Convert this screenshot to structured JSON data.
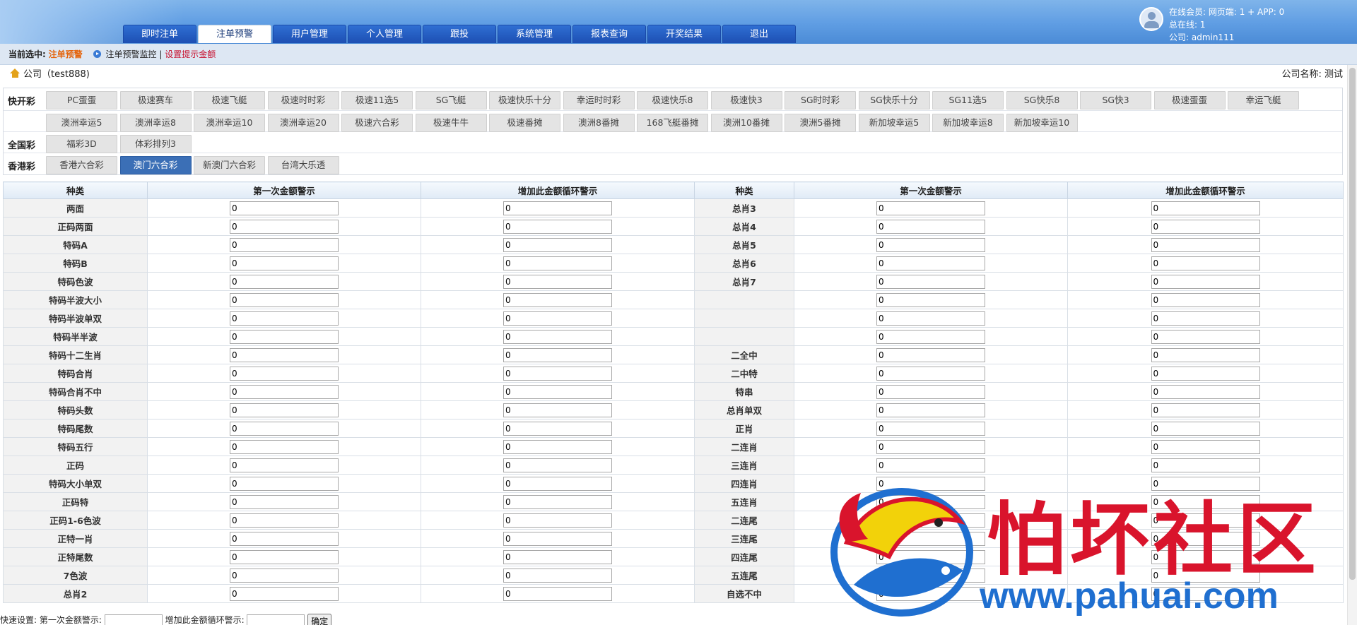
{
  "nav": {
    "tabs": [
      "即时注单",
      "注单预警",
      "用户管理",
      "个人管理",
      "跟投",
      "系统管理",
      "报表查询",
      "开奖结果",
      "退出"
    ],
    "active": 1
  },
  "user": {
    "online": "在线会员:   网页端: 1 + APP: 0",
    "total": "总在线: 1",
    "company": "公司: admin111"
  },
  "crumb": {
    "label": "当前选中:",
    "current": "注单预警",
    "item": "注单预警监控",
    "sep": "|",
    "link": "设置提示金额"
  },
  "company": {
    "title": "公司（test888)",
    "name": "公司名称: 测试"
  },
  "categories": {
    "fast_label": "快开彩",
    "fast_row1": [
      "PC蛋蛋",
      "极速赛车",
      "极速飞艇",
      "极速时时彩",
      "极速11选5",
      "SG飞艇",
      "极速快乐十分",
      "幸运时时彩",
      "极速快乐8",
      "极速快3",
      "SG时时彩",
      "SG快乐十分",
      "SG11选5",
      "SG快乐8",
      "SG快3",
      "极速蛋蛋",
      "幸运飞艇"
    ],
    "fast_row2": [
      "澳洲幸运5",
      "澳洲幸运8",
      "澳洲幸运10",
      "澳洲幸运20",
      "极速六合彩",
      "极速牛牛",
      "极速番摊",
      "澳洲8番摊",
      "168飞艇番摊",
      "澳洲10番摊",
      "澳洲5番摊",
      "新加坡幸运5",
      "新加坡幸运8",
      "新加坡幸运10"
    ],
    "national_label": "全国彩",
    "national": [
      "福彩3D",
      "体彩排列3"
    ],
    "hk_label": "香港彩",
    "hk": [
      "香港六合彩",
      "澳门六合彩",
      "新澳门六合彩",
      "台湾大乐透"
    ],
    "hk_active": 1
  },
  "table": {
    "headers": [
      "种类",
      "第一次金额警示",
      "增加此金额循环警示",
      "种类",
      "第一次金额警示",
      "增加此金额循环警示"
    ],
    "rows": [
      [
        "两面",
        "0",
        "0",
        "总肖3",
        "0",
        "0"
      ],
      [
        "正码两面",
        "0",
        "0",
        "总肖4",
        "0",
        "0"
      ],
      [
        "特码A",
        "0",
        "0",
        "总肖5",
        "0",
        "0"
      ],
      [
        "特码B",
        "0",
        "0",
        "总肖6",
        "0",
        "0"
      ],
      [
        "特码色波",
        "0",
        "0",
        "总肖7",
        "0",
        "0"
      ],
      [
        "特码半波大小",
        "0",
        "0",
        "",
        "0",
        "0"
      ],
      [
        "特码半波单双",
        "0",
        "0",
        "",
        "0",
        "0"
      ],
      [
        "特码半半波",
        "0",
        "0",
        "",
        "0",
        "0"
      ],
      [
        "特码十二生肖",
        "0",
        "0",
        "二全中",
        "0",
        "0"
      ],
      [
        "特码合肖",
        "0",
        "0",
        "二中特",
        "0",
        "0"
      ],
      [
        "特码合肖不中",
        "0",
        "0",
        "特串",
        "0",
        "0"
      ],
      [
        "特码头数",
        "0",
        "0",
        "总肖单双",
        "0",
        "0"
      ],
      [
        "特码尾数",
        "0",
        "0",
        "正肖",
        "0",
        "0"
      ],
      [
        "特码五行",
        "0",
        "0",
        "二连肖",
        "0",
        "0"
      ],
      [
        "正码",
        "0",
        "0",
        "三连肖",
        "0",
        "0"
      ],
      [
        "特码大小单双",
        "0",
        "0",
        "四连肖",
        "0",
        "0"
      ],
      [
        "正码特",
        "0",
        "0",
        "五连肖",
        "0",
        "0"
      ],
      [
        "正码1-6色波",
        "0",
        "0",
        "二连尾",
        "0",
        "0"
      ],
      [
        "正特一肖",
        "0",
        "0",
        "三连尾",
        "0",
        "0"
      ],
      [
        "正特尾数",
        "0",
        "0",
        "四连尾",
        "0",
        "0"
      ],
      [
        "7色波",
        "0",
        "0",
        "五连尾",
        "0",
        "0"
      ],
      [
        "总肖2",
        "0",
        "0",
        "自选不中",
        "0",
        "0"
      ]
    ]
  },
  "quick": {
    "label1": "快速设置:   第一次金额警示:",
    "label2": "增加此金额循环警示:",
    "button": "确定"
  },
  "watermark": {
    "text": "怕坏社区",
    "url": "www.pahuai.com"
  },
  "colors": {
    "nav_tab": "#1d4fb3",
    "active_pill": "#3b6fb6",
    "crumb_current": "#e4640c",
    "crumb_link": "#c8102e",
    "watermark_red": "#d9142c",
    "watermark_blue": "#1f6fd0"
  }
}
